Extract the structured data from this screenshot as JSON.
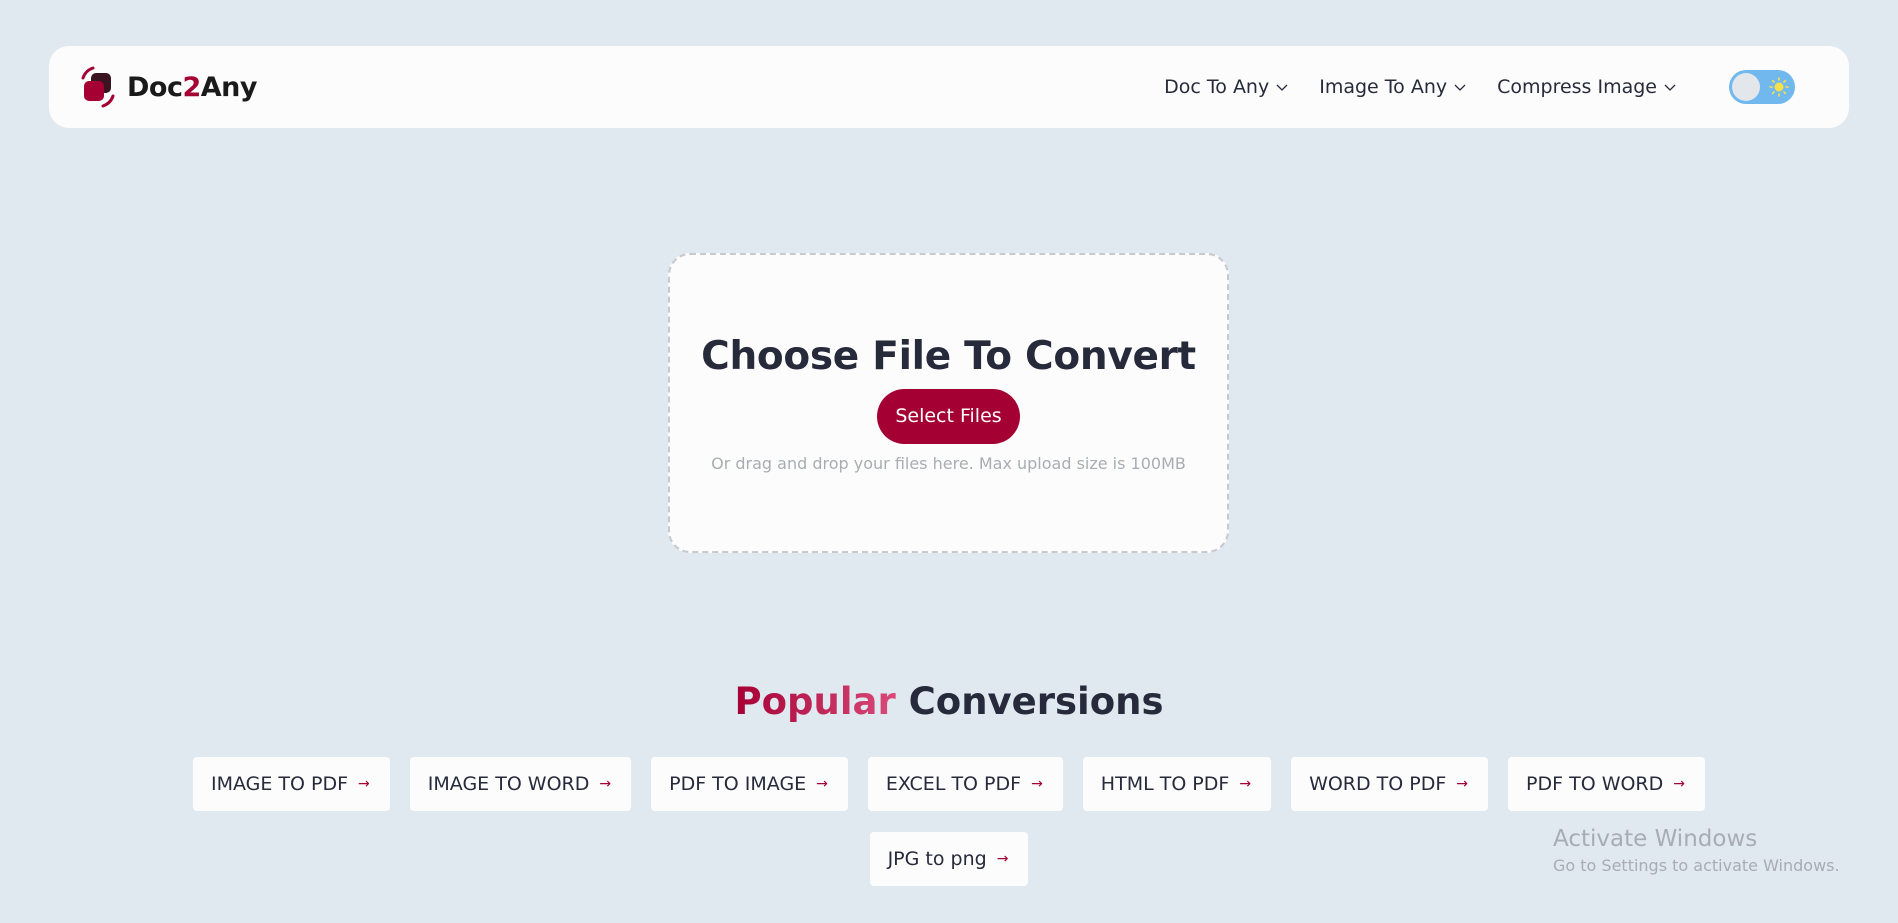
{
  "header": {
    "brand_prefix": "Doc",
    "brand_accent": "2",
    "brand_suffix": "Any",
    "nav": [
      {
        "label": "Doc To Any"
      },
      {
        "label": "Image To Any"
      },
      {
        "label": "Compress Image"
      }
    ],
    "theme_toggle_icon": "sun-icon"
  },
  "upload": {
    "title": "Choose File To Convert",
    "button_label": "Select Files",
    "hint": "Or drag and drop your files here. Max upload size is 100MB"
  },
  "popular": {
    "title_highlight": "Popular",
    "title_rest": "Conversions",
    "items": [
      {
        "label": "IMAGE TO PDF"
      },
      {
        "label": "IMAGE TO WORD"
      },
      {
        "label": "PDF TO IMAGE"
      },
      {
        "label": "EXCEL TO PDF"
      },
      {
        "label": "HTML TO PDF"
      },
      {
        "label": "WORD TO PDF"
      },
      {
        "label": "PDF TO WORD"
      },
      {
        "label": "JPG to png"
      }
    ],
    "arrow_glyph": "→"
  },
  "watermark": {
    "title": "Activate Windows",
    "subtitle": "Go to Settings to activate Windows."
  },
  "colors": {
    "accent": "#a50034",
    "background": "#e0e8f0",
    "toggle": "#71b8ee"
  }
}
